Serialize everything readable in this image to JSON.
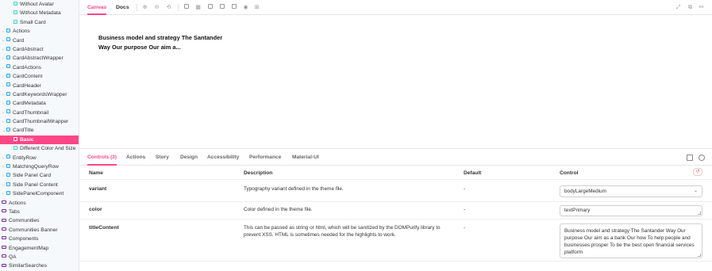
{
  "sidebar": {
    "items": [
      {
        "label": "Without Avatar",
        "type": "story",
        "level": 3
      },
      {
        "label": "Without Metadata",
        "type": "story",
        "level": 3
      },
      {
        "label": "Small Card",
        "type": "story",
        "level": 3
      },
      {
        "label": "Actions",
        "type": "component",
        "level": 2
      },
      {
        "label": "Card",
        "type": "component",
        "level": 2
      },
      {
        "label": "CardAbstract",
        "type": "component",
        "level": 2
      },
      {
        "label": "CardAbstractWrapper",
        "type": "component",
        "level": 2
      },
      {
        "label": "CardActions",
        "type": "component",
        "level": 2
      },
      {
        "label": "CardContent",
        "type": "component",
        "level": 2
      },
      {
        "label": "CardHeader",
        "type": "component",
        "level": 2
      },
      {
        "label": "CardKeywordsWrapper",
        "type": "component",
        "level": 2
      },
      {
        "label": "CardMetadata",
        "type": "component",
        "level": 2
      },
      {
        "label": "CardThumbnail",
        "type": "component",
        "level": 2
      },
      {
        "label": "CardThumbnailWrapper",
        "type": "component",
        "level": 2
      },
      {
        "label": "CardTitle",
        "type": "component",
        "level": 2,
        "expanded": true
      },
      {
        "label": "Basic",
        "type": "story",
        "level": 3,
        "selected": true
      },
      {
        "label": "Different Color And Size",
        "type": "story",
        "level": 3
      },
      {
        "label": "EntityRow",
        "type": "component",
        "level": 2
      },
      {
        "label": "MatchingQueryRow",
        "type": "component",
        "level": 2
      },
      {
        "label": "Side Panel Card",
        "type": "component",
        "level": 2
      },
      {
        "label": "Side Panel Content",
        "type": "component",
        "level": 2
      },
      {
        "label": "SidePanelComponent",
        "type": "component",
        "level": 2
      },
      {
        "label": "Actions",
        "type": "folder",
        "level": 1
      },
      {
        "label": "Tabs",
        "type": "folder",
        "level": 1
      },
      {
        "label": "Communities",
        "type": "folder",
        "level": 1
      },
      {
        "label": "Communities Banner",
        "type": "folder",
        "level": 1
      },
      {
        "label": "Components",
        "type": "folder",
        "level": 1
      },
      {
        "label": "EngagementMap",
        "type": "folder",
        "level": 1
      },
      {
        "label": "QA",
        "type": "folder",
        "level": 1
      },
      {
        "label": "SimilarSearches",
        "type": "folder",
        "level": 1
      }
    ]
  },
  "toolbar": {
    "tabs": [
      "Canvas",
      "Docs"
    ],
    "active_tab": "Canvas",
    "icons": [
      "zoom-in-icon",
      "zoom-out-icon",
      "zoom-reset-icon",
      "background-icon",
      "grid-icon",
      "viewport-icon",
      "layout-icon",
      "outline-icon",
      "measure-icon",
      "grid-lines-icon"
    ],
    "right_icons": [
      "fullscreen-icon",
      "open-new-tab-icon",
      "copy-link-icon"
    ]
  },
  "canvas": {
    "title_text": "Business model and strategy The Santander Way Our purpose Our aim a..."
  },
  "addons": {
    "tabs": [
      "Controls (3)",
      "Actions",
      "Story",
      "Design",
      "Accessibility",
      "Performance",
      "Material-UI"
    ],
    "active_tab": "Controls (3)",
    "columns": {
      "name": "Name",
      "description": "Description",
      "default": "Default",
      "control": "Control"
    },
    "rows": [
      {
        "name": "variant",
        "description": "Typography variant defined in the theme file.",
        "default": "-",
        "control_type": "select",
        "value": "bodyLargeMedium"
      },
      {
        "name": "color",
        "description": "Color defined in the theme file.",
        "default": "-",
        "control_type": "text",
        "value": "textPrimary"
      },
      {
        "name": "titleContent",
        "description": "This can be passed as string or html, which will be sanitized by the DOMPurify library to prevent XSS. HTML is sometimes needed for the highlights to work.",
        "default": "-",
        "control_type": "textarea",
        "value": "Business model and strategy The Santander Way Our purpose Our aim as a bank Our how To help people and businesses prosper To be the best open financial services platform"
      }
    ]
  },
  "colors": {
    "accent": "#ff4785",
    "story_icon": "#37d5d3",
    "component_icon": "#1ea7fd",
    "folder_icon": "#6f2cac"
  }
}
